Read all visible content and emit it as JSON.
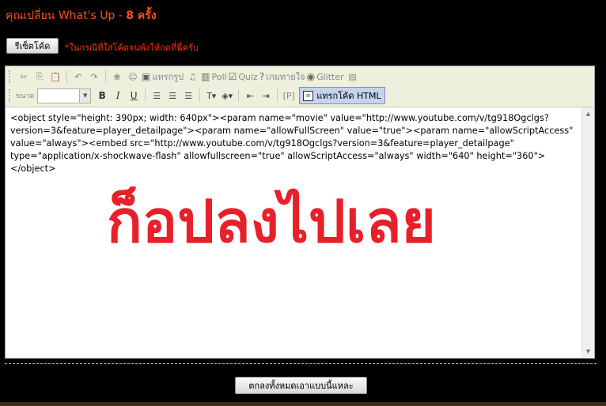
{
  "header": {
    "title": "คุณเปลี่ยน What's Up - ",
    "count": "8 ครั้ง"
  },
  "reset_button": "รีเซ็ตโค้ด",
  "hint": "*ในกรณีที่ใส่โค้ดจนพังให้กดที่นี่ครับ",
  "toolbar": {
    "insert_image": "แทรกรูป",
    "poll": "Poll",
    "quiz": "Quiz",
    "guess_game": "เกมทายใจ",
    "glitter": "Glitter",
    "size_label": "ขนาด",
    "bold": "B",
    "italic": "I",
    "underline": "U",
    "paragraph": "[P]",
    "insert_html": "แทรกโค้ด HTML"
  },
  "editor": {
    "code": "<object style=\"height: 390px; width: 640px\"><param name=\"movie\" value=\"http://www.youtube.com/v/tg918Ogclgs?version=3&feature=player_detailpage\"><param name=\"allowFullScreen\" value=\"true\"><param name=\"allowScriptAccess\" value=\"always\"><embed src=\"http://www.youtube.com/v/tg918Ogclgs?version=3&feature=player_detailpage\" type=\"application/x-shockwave-flash\" allowfullscreen=\"true\" allowScriptAccess=\"always\" width=\"640\" height=\"360\"></object>",
    "overlay_text": "ก็อปลงไปเลย"
  },
  "submit_button": "ตกลงทั้งหมดเอาแบบนี้แหละ",
  "colors": {
    "heading": "#ff4d1a",
    "overlay": "#e8202a"
  }
}
